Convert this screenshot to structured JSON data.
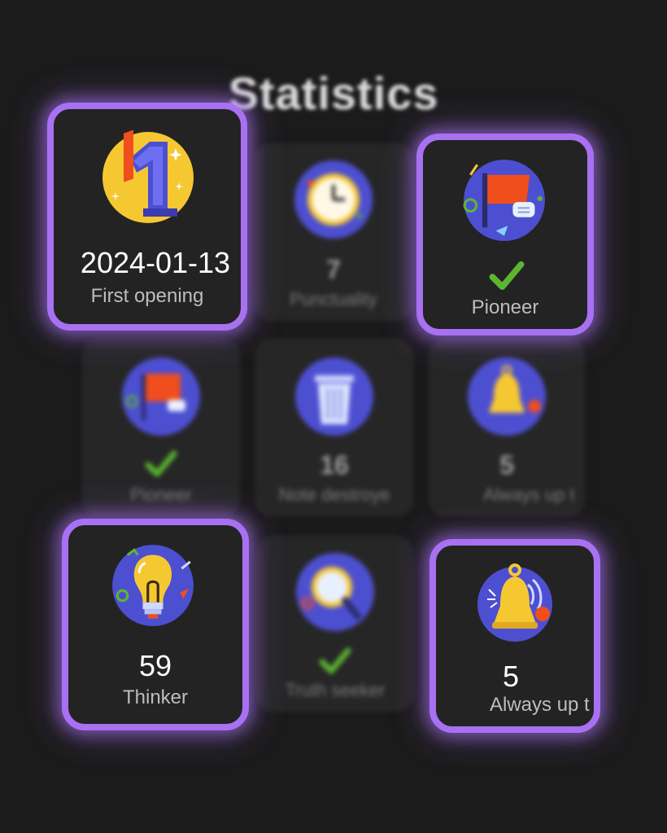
{
  "page": {
    "title": "Statistics"
  },
  "colors": {
    "background": "#1b1b1b",
    "card_background": "#232323",
    "highlight_border": "#a771f2",
    "check_green": "#5cb531",
    "icon_purple": "#4d4fd1",
    "accent_yellow": "#f5c832",
    "accent_orange": "#f04e1c"
  },
  "highlighted_achievements": [
    {
      "value": "2024-01-13",
      "label": "First opening",
      "icon": "number-one-badge-icon",
      "completed": false
    },
    {
      "value": "",
      "label": "Pioneer",
      "icon": "flag-badge-icon",
      "completed": true
    },
    {
      "value": "59",
      "label": "Thinker",
      "icon": "lightbulb-badge-icon",
      "completed": false
    },
    {
      "value": "5",
      "label": "Always up t",
      "icon": "bell-badge-icon",
      "completed": false
    }
  ],
  "background_achievements": [
    {
      "value": "7",
      "label": "Punctuality",
      "icon": "clock-badge-icon",
      "completed": false
    },
    {
      "value": "",
      "label": "Pioneer",
      "icon": "flag-badge-icon",
      "completed": true
    },
    {
      "value": "16",
      "label": "Note destroye",
      "icon": "trash-badge-icon",
      "completed": false
    },
    {
      "value": "5",
      "label": "Always up t",
      "icon": "bell-badge-icon",
      "completed": false
    },
    {
      "value": "",
      "label": "Truth seeker",
      "icon": "magnifier-badge-icon",
      "completed": true
    }
  ]
}
